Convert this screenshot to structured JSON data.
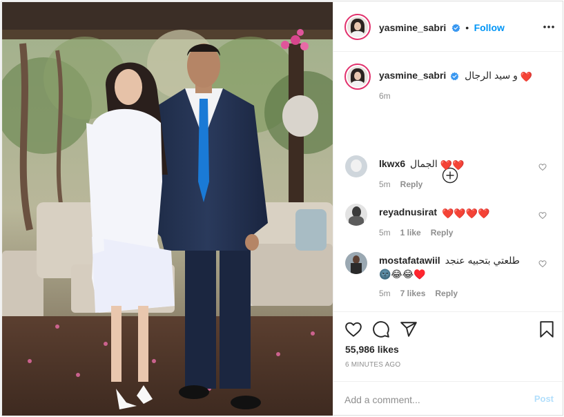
{
  "post": {
    "username": "yasmine_sabri",
    "follow_label": "Follow",
    "separator": "•",
    "caption": {
      "username": "yasmine_sabri",
      "text": "و سيد الرجال",
      "emoji": "❤️",
      "time": "6m"
    },
    "comments": [
      {
        "username": "lkwx6",
        "text": "الجمال",
        "emoji": "❤️❤️",
        "time": "5m",
        "likes": "",
        "reply": "Reply"
      },
      {
        "username": "reyadnusirat",
        "text": "",
        "emoji": "❤️❤️❤️❤️",
        "time": "5m",
        "likes": "1 like",
        "reply": "Reply"
      },
      {
        "username": "mostafatawiil",
        "text": "طلعتي بتحبيه عنجد",
        "emoji": "🌚😂😂♥️",
        "time": "5m",
        "likes": "7 likes",
        "reply": "Reply"
      }
    ],
    "likes": "55,986 likes",
    "time_ago": "6 MINUTES AGO",
    "comment_placeholder": "Add a comment...",
    "post_label": "Post"
  },
  "icons": {
    "verified": "verified-badge-icon",
    "more": "more-options-icon",
    "load_more": "plus-circle-icon",
    "like": "heart-icon",
    "comment": "comment-icon",
    "share": "paper-plane-icon",
    "save": "bookmark-icon"
  },
  "colors": {
    "accent": "#0095f6",
    "post_disabled": "#b2dffc",
    "heart": "#e0245e",
    "muted": "#8e8e8e"
  }
}
